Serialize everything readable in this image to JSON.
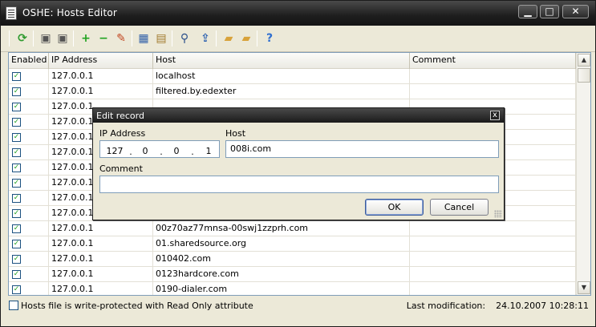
{
  "window": {
    "title": "OSHE: Hosts Editor",
    "controls": {
      "minimize": "▁",
      "maximize": "□",
      "close": "✕"
    }
  },
  "toolbar": {
    "buttons": [
      {
        "name": "refresh-icon",
        "glyph": "⟳",
        "color": "#2e9a2e"
      },
      {
        "name": "save-icon",
        "glyph": "▣",
        "color": "#555555"
      },
      {
        "name": "save-all-icon",
        "glyph": "▣",
        "color": "#555555"
      },
      {
        "name": "add-record-icon",
        "glyph": "+",
        "color": "#1fa31f"
      },
      {
        "name": "remove-record-icon",
        "glyph": "−",
        "color": "#1fa31f"
      },
      {
        "name": "edit-record-icon",
        "glyph": "✎",
        "color": "#c2451f"
      },
      {
        "name": "table-view-icon",
        "glyph": "▦",
        "color": "#2f5fa8"
      },
      {
        "name": "notepad-icon",
        "glyph": "▤",
        "color": "#a07a2c"
      },
      {
        "name": "search-icon",
        "glyph": "⚲",
        "color": "#2a4f8a"
      },
      {
        "name": "import-icon",
        "glyph": "⇪",
        "color": "#2a5fb0"
      },
      {
        "name": "open-folder-icon",
        "glyph": "▰",
        "color": "#d8a23a"
      },
      {
        "name": "open-folder-alt-icon",
        "glyph": "▰",
        "color": "#d8a23a"
      },
      {
        "name": "help-icon",
        "glyph": "?",
        "color": "#2f6fd0"
      }
    ]
  },
  "grid": {
    "columns": [
      "Enabled",
      "IP Address",
      "Host",
      "Comment"
    ],
    "rows": [
      {
        "enabled": true,
        "ip": "127.0.0.1",
        "host": "localhost",
        "comment": ""
      },
      {
        "enabled": true,
        "ip": "127.0.0.1",
        "host": "filtered.by.edexter",
        "comment": ""
      },
      {
        "enabled": true,
        "ip": "127.0.0.1",
        "host": "",
        "comment": ""
      },
      {
        "enabled": true,
        "ip": "127.0.0.1",
        "host": "",
        "comment": ""
      },
      {
        "enabled": true,
        "ip": "127.0.0.1",
        "host": "",
        "comment": ""
      },
      {
        "enabled": true,
        "ip": "127.0.0.1",
        "host": "",
        "comment": ""
      },
      {
        "enabled": true,
        "ip": "127.0.0.1",
        "host": "",
        "comment": ""
      },
      {
        "enabled": true,
        "ip": "127.0.0.1",
        "host": "",
        "comment": ""
      },
      {
        "enabled": true,
        "ip": "127.0.0.1",
        "host": "",
        "comment": ""
      },
      {
        "enabled": true,
        "ip": "127.0.0.1",
        "host": "",
        "comment": ""
      },
      {
        "enabled": true,
        "ip": "127.0.0.1",
        "host": "00z70az77mnsa-00swj1zzprh.com",
        "comment": ""
      },
      {
        "enabled": true,
        "ip": "127.0.0.1",
        "host": "01.sharedsource.org",
        "comment": ""
      },
      {
        "enabled": true,
        "ip": "127.0.0.1",
        "host": "010402.com",
        "comment": ""
      },
      {
        "enabled": true,
        "ip": "127.0.0.1",
        "host": "0123hardcore.com",
        "comment": ""
      },
      {
        "enabled": true,
        "ip": "127.0.0.1",
        "host": "0190-dialer.com",
        "comment": ""
      }
    ]
  },
  "status": {
    "readonly_label": "Hosts file is write-protected with Read Only attribute",
    "last_modification_label": "Last modification:",
    "last_modification_value": "24.10.2007 10:28:11"
  },
  "dialog": {
    "title": "Edit record",
    "close": "x",
    "ip_label": "IP Address",
    "ip_segments": [
      "127",
      "0",
      "0",
      "1"
    ],
    "host_label": "Host",
    "host_value": "008i.com",
    "comment_label": "Comment",
    "comment_value": "",
    "ok_label": "OK",
    "cancel_label": "Cancel"
  }
}
